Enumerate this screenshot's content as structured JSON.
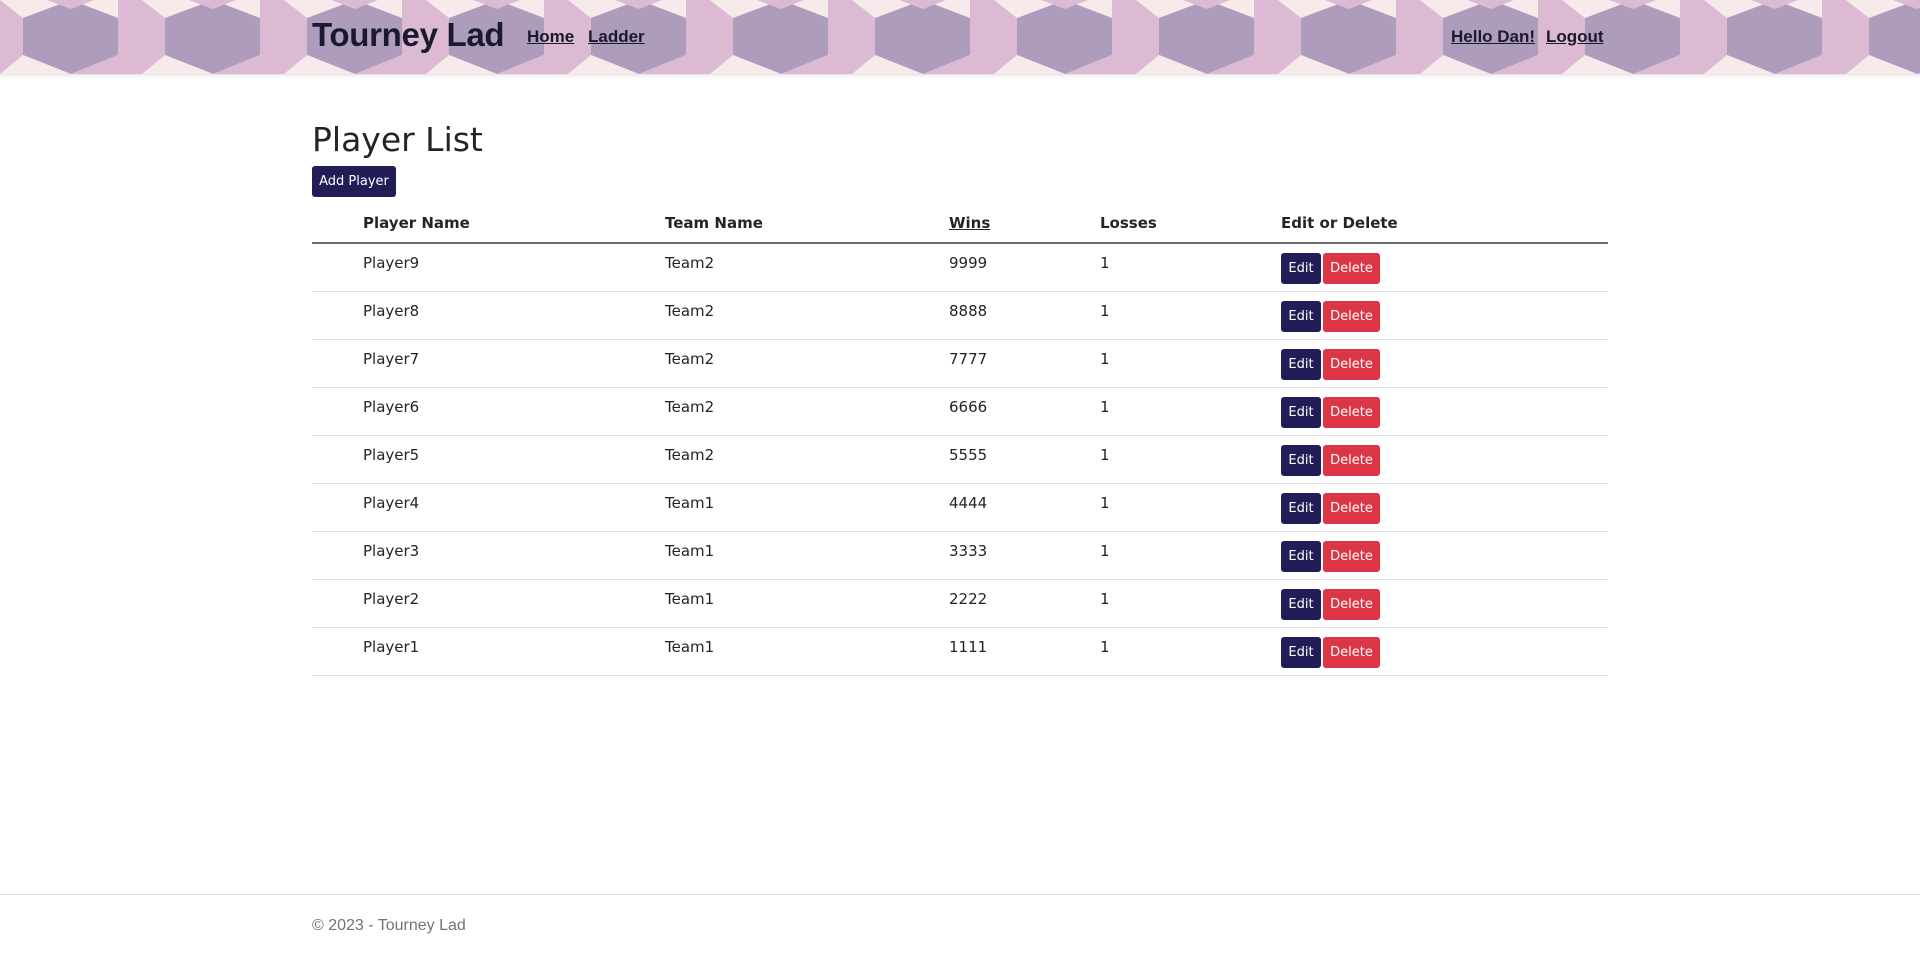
{
  "header": {
    "brand": "Tourney Lad",
    "nav": {
      "home": "Home",
      "ladder": "Ladder"
    },
    "user": {
      "greeting": "Hello Dan!",
      "logout": "Logout"
    },
    "pattern_colors": [
      "#ae9cbc",
      "#dcbad4",
      "#f8ecec"
    ]
  },
  "main": {
    "title": "Player List",
    "add_button": "Add Player",
    "table": {
      "columns": {
        "player_name": "Player Name",
        "team_name": "Team Name",
        "wins": "Wins",
        "losses": "Losses",
        "actions": "Edit or Delete"
      },
      "edit_label": "Edit",
      "delete_label": "Delete",
      "rows": [
        {
          "player": "Player9",
          "team": "Team2",
          "wins": "9999",
          "losses": "1"
        },
        {
          "player": "Player8",
          "team": "Team2",
          "wins": "8888",
          "losses": "1"
        },
        {
          "player": "Player7",
          "team": "Team2",
          "wins": "7777",
          "losses": "1"
        },
        {
          "player": "Player6",
          "team": "Team2",
          "wins": "6666",
          "losses": "1"
        },
        {
          "player": "Player5",
          "team": "Team2",
          "wins": "5555",
          "losses": "1"
        },
        {
          "player": "Player4",
          "team": "Team1",
          "wins": "4444",
          "losses": "1"
        },
        {
          "player": "Player3",
          "team": "Team1",
          "wins": "3333",
          "losses": "1"
        },
        {
          "player": "Player2",
          "team": "Team1",
          "wins": "2222",
          "losses": "1"
        },
        {
          "player": "Player1",
          "team": "Team1",
          "wins": "1111",
          "losses": "1"
        }
      ]
    }
  },
  "footer": {
    "text": "© 2023 - Tourney Lad"
  },
  "colors": {
    "primary": "#221d56",
    "danger": "#dc3545"
  }
}
